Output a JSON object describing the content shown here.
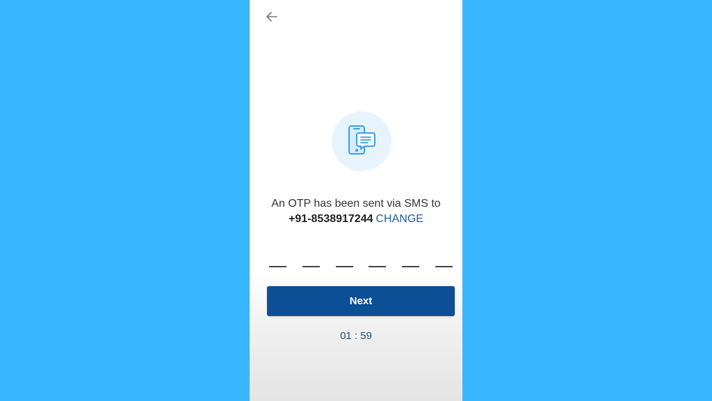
{
  "header": {
    "back_icon": "arrow-left-icon"
  },
  "illustration": {
    "icon": "phone-message-icon"
  },
  "message": {
    "line1": "An OTP has been sent via SMS to",
    "phone": "+91-8538917244",
    "change_label": "CHANGE"
  },
  "otp": {
    "digits": [
      "",
      "",
      "",
      "",
      "",
      ""
    ]
  },
  "actions": {
    "next_label": "Next"
  },
  "timer": {
    "value": "01 : 59"
  },
  "colors": {
    "background": "#38b6ff",
    "primary": "#0d4f94",
    "link": "#1c5f9a",
    "icon_bg": "#e8f4fd",
    "icon": "#3aa0e8"
  }
}
